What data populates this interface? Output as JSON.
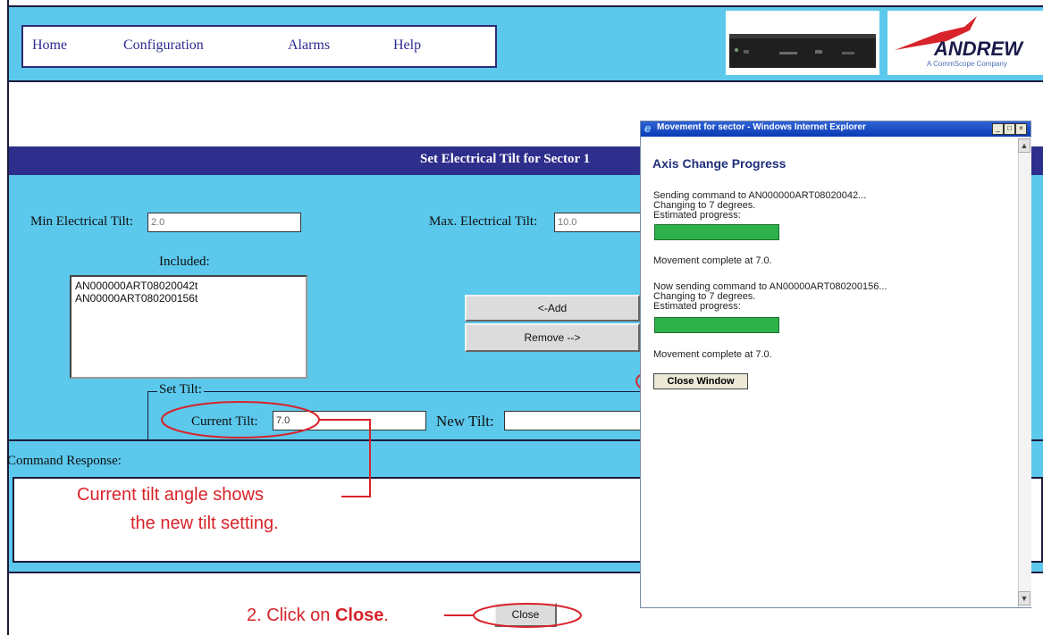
{
  "nav": {
    "home": "Home",
    "configuration": "Configuration",
    "alarms": "Alarms",
    "help": "Help"
  },
  "logo": {
    "brand": "ANDREW",
    "tagline": "A CommScope Company"
  },
  "title_bar": {
    "title": "Set Electrical Tilt for Sector 1"
  },
  "form": {
    "min_tilt_label": "Min Electrical Tilt:",
    "min_tilt_value": "2.0",
    "max_tilt_label": "Max. Electrical Tilt:",
    "max_tilt_value": "10.0",
    "included_label": "Included:",
    "included_items": [
      "AN000000ART08020042t",
      "AN00000ART080200156t"
    ],
    "add_button": "<-Add",
    "remove_button": "Remove -->",
    "set_tilt_legend": "Set Tilt:",
    "current_tilt_label": "Current Tilt:",
    "current_tilt_value": "7.0",
    "new_tilt_label": "New Tilt:",
    "new_tilt_value": ""
  },
  "command_response": {
    "label": "Command Response:"
  },
  "annotations": {
    "current_tilt_line1": "Current tilt angle shows",
    "current_tilt_line2": "the new tilt setting.",
    "click_close_prefix": "2.  Click on ",
    "click_close_bold": "Close",
    "click_close_suffix": "."
  },
  "close_button": "Close",
  "popup": {
    "window_title": "Movement for sector - Windows Internet Explorer",
    "heading": "Axis Change Progress",
    "line1": "Sending command to AN000000ART08020042...",
    "line2": "Changing to 7 degrees.",
    "line3": "Estimated progress:",
    "progress1": 1.0,
    "line4": "Movement complete at 7.0.",
    "line5": "Now sending command to AN00000ART080200156...",
    "line6": "Changing to 7 degrees.",
    "line7": "Estimated progress:",
    "progress2": 1.0,
    "line8": "Movement complete at 7.0.",
    "close_window_button": "Close Window"
  },
  "colors": {
    "page_bg": "#5bc8ec",
    "title_bar": "#2e2e8c",
    "annotation": "#d8232a",
    "progress": "#2db24b"
  }
}
